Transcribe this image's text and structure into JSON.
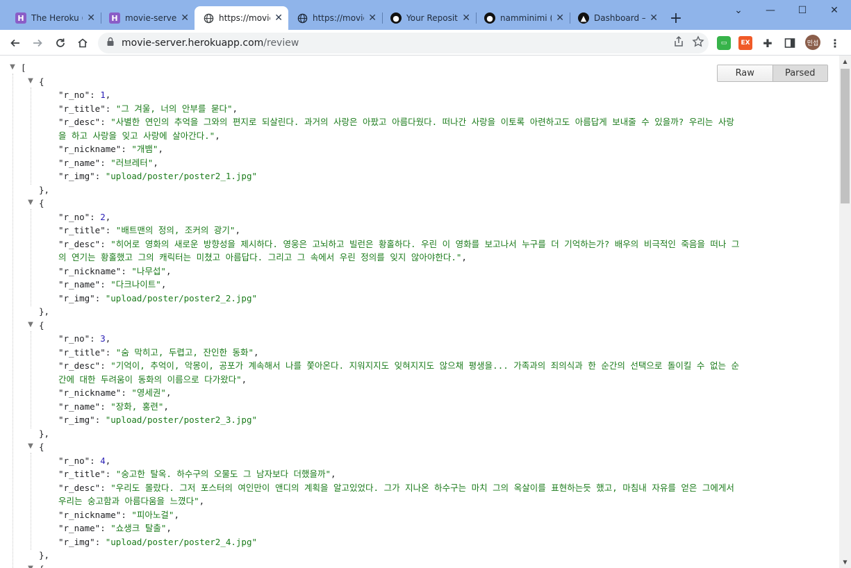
{
  "tabs": [
    {
      "title": "The Heroku (",
      "icon": "heroku-icon"
    },
    {
      "title": "movie-server",
      "icon": "heroku-icon"
    },
    {
      "title": "https://movie",
      "icon": "globe-icon",
      "active": true
    },
    {
      "title": "https://movie",
      "icon": "globe-icon"
    },
    {
      "title": "Your Reposit",
      "icon": "github-icon"
    },
    {
      "title": "namminimi (",
      "icon": "github-icon"
    },
    {
      "title": "Dashboard –",
      "icon": "vercel-icon"
    }
  ],
  "address_bar": {
    "host": "movie-server.herokuapp.com",
    "path": "/review"
  },
  "avatar_label": "민섭",
  "viewer": {
    "raw_label": "Raw",
    "parsed_label": "Parsed"
  },
  "reviews": [
    {
      "r_no": "1",
      "r_title": "\"그 겨울, 너의 안부를 묻다\"",
      "r_desc_1": "\"사별한 연인의 추억을 그와의 편지로 되살린다. 과거의 사랑은 아팠고 아름다웠다. 떠나간 사랑을 이토록 아련하고도 아름답게 보내줄 수 있을까? 우리는 사랑",
      "r_desc_2": "을 하고 사랑을 잊고 사랑에 살아간다.\"",
      "r_nickname": "\"개뱀\"",
      "r_name": "\"러브레터\"",
      "r_img": "\"upload/poster/poster2_1.jpg\""
    },
    {
      "r_no": "2",
      "r_title": "\"배트맨의 정의, 조커의 광기\"",
      "r_desc_1": "\"히어로 영화의 새로운 방향성을 제시하다. 영웅은 고뇌하고 빌런은 황홀하다. 우린 이 영화를 보고나서 누구를 더 기억하는가? 배우의 비극적인 죽음을 떠나 그",
      "r_desc_2": "의 연기는 황홀했고 그의 캐릭터는 미쳤고 아름답다. 그리고 그 속에서 우린 정의를 잊지 않아야한다.\"",
      "r_nickname": "\"나무섭\"",
      "r_name": "\"다크나이트\"",
      "r_img": "\"upload/poster/poster2_2.jpg\""
    },
    {
      "r_no": "3",
      "r_title": "\"숨 막히고, 두렵고, 잔인한 동화\"",
      "r_desc_1": "\"기억이, 추억이, 악몽이, 공포가 계속해서 나를 쫓아온다. 지워지지도 잊혀지지도 않으채 평생을... 가족과의 죄의식과 한 순간의 선택으로 돌이킬 수 없는 순",
      "r_desc_2": "간에 대한 두려움이 동화의 이름으로 다가왔다\"",
      "r_nickname": "\"영세권\"",
      "r_name": "\"장화, 홍련\"",
      "r_img": "\"upload/poster/poster2_3.jpg\""
    },
    {
      "r_no": "4",
      "r_title": "\"숭고한 탈옥. 하수구의 오물도 그 남자보다 더했을까\"",
      "r_desc_1": "\"우리도 몰랐다. 그저 포스터의 여인만이 앤디의 계획을 알고있었다. 그가 지나온 하수구는 마치 그의 옥살이를 표현하는듯 했고, 마침내 자유를 얻은 그에게서",
      "r_desc_2": "우리는 숭고함과 아름다움을 느꼈다\"",
      "r_nickname": "\"피아노걸\"",
      "r_name": "\"쇼생크 탈출\"",
      "r_img": "\"upload/poster/poster2_4.jpg\""
    }
  ],
  "keys": {
    "r_no": "\"r_no\"",
    "r_title": "\"r_title\"",
    "r_desc": "\"r_desc\"",
    "r_nickname": "\"r_nickname\"",
    "r_name": "\"r_name\"",
    "r_img": "\"r_img\""
  }
}
